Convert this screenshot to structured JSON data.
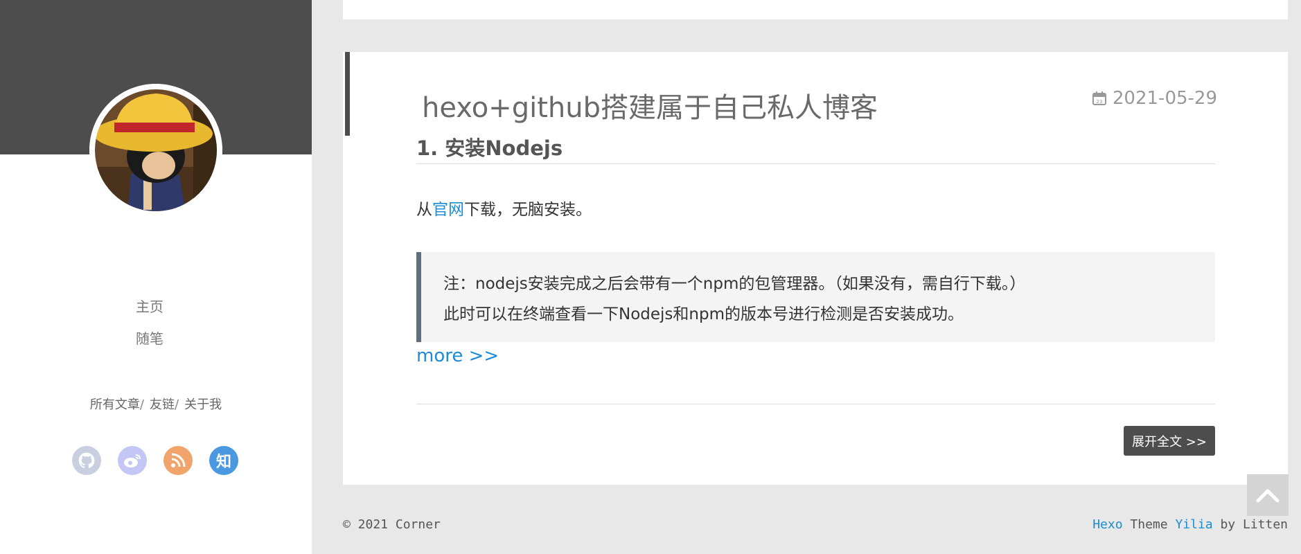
{
  "sidebar": {
    "nav": [
      {
        "label": "主页"
      },
      {
        "label": "随笔"
      }
    ],
    "links": [
      {
        "label": "所有文章",
        "sep": "/"
      },
      {
        "label": "友链",
        "sep": "/"
      },
      {
        "label": "关于我",
        "sep": ""
      }
    ],
    "social": [
      {
        "icon": "github-icon",
        "color": "#c9cfe0"
      },
      {
        "icon": "weibo-icon",
        "color": "#c4c6f5"
      },
      {
        "icon": "rss-icon",
        "color": "#f0a46c"
      },
      {
        "icon": "zhihu-icon",
        "color": "#4a98e0",
        "glyph": "知"
      }
    ]
  },
  "article": {
    "title": "hexo+github搭建属于自己私人博客",
    "date": "2021-05-29",
    "heading": "1. 安装Nodejs",
    "para": {
      "before": "从",
      "link": "官网",
      "after": "下载，无脑安装。"
    },
    "quote": [
      "注：nodejs安装完成之后会带有一个npm的包管理器。（如果没有，需自行下载。）",
      "此时可以在终端查看一下Nodejs和npm的版本号进行检测是否安装成功。"
    ],
    "more": "more >>",
    "expand_button": "展开全文 >>"
  },
  "footer": {
    "copyright": "© 2021 Corner",
    "hexo": "Hexo",
    "theme_text": " Theme ",
    "yilia": "Yilia",
    "by_text": " by Litten"
  },
  "colors": {
    "dark_header": "#4d4d4d",
    "link": "#1c8bd6",
    "background": "#e8e8e8"
  }
}
